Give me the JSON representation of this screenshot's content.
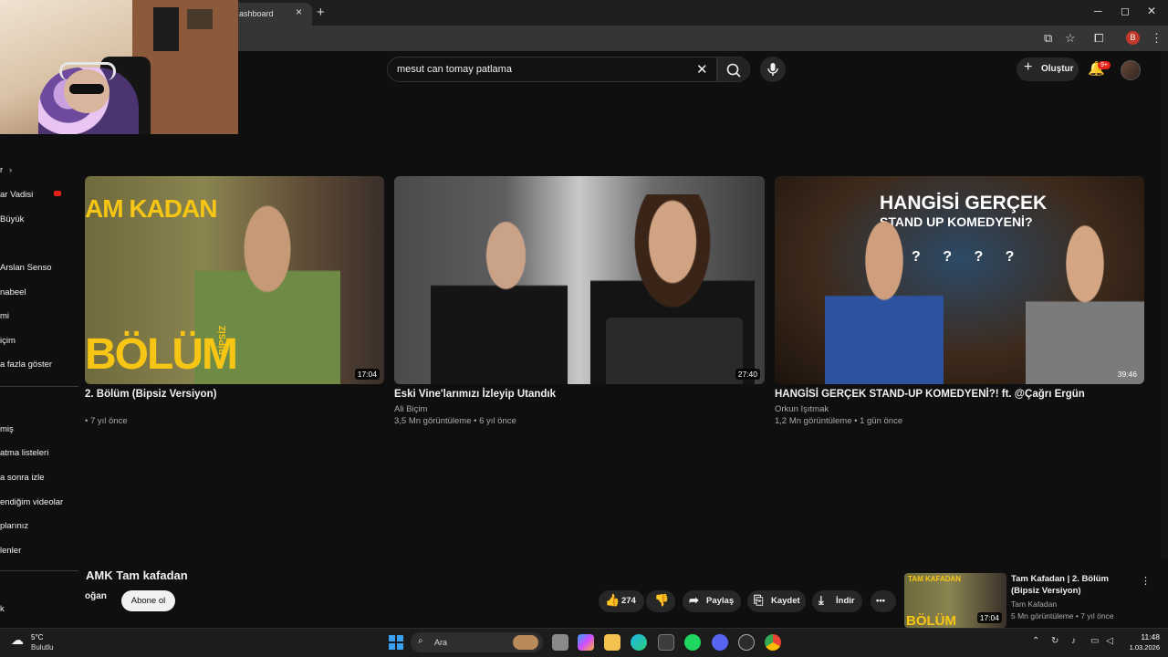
{
  "browser": {
    "tab_title": "ashboard",
    "tab_close": "×",
    "new_tab": "+",
    "window_controls": [
      "─",
      "◻",
      "✕"
    ],
    "profile_letter": "B"
  },
  "header": {
    "search_value": "mesut can tomay patlama",
    "create_label": "Oluştur",
    "notification_badge": "9+"
  },
  "sidebar": {
    "items": [
      "r",
      "ar Vadisi",
      "Büyük",
      "Arslan Senso",
      "nabeel",
      "mi",
      "içim",
      "a fazla göster",
      "miş",
      "atma listeleri",
      "a sonra izle",
      "endiğim videolar",
      "plarınız",
      "lenler",
      "k"
    ]
  },
  "videos": [
    {
      "title": "2. Bölüm (Bipsiz Versiyon)",
      "channel": "",
      "meta": "• 7 yıl önce",
      "duration": "17:04",
      "thumb_text": "BÖLÜM",
      "thumb_brand": "AM KADAN",
      "thumb_side": "BİPSİZ"
    },
    {
      "title": "Eski Vine'larımızı İzleyip Utandık",
      "channel": "Ali Biçim",
      "meta": "3,5 Mn görüntüleme • 6 yıl önce",
      "duration": "27:40"
    },
    {
      "title": "HANGİSİ GERÇEK STAND-UP KOMEDYENİ?! ft. @Çağrı Ergün",
      "channel": "Orkun Işıtmak",
      "meta": "1,2 Mn görüntüleme • 1 gün önce",
      "duration": "39:46",
      "thumb_line1": "HANGİSİ GERÇEK",
      "thumb_line2": "STAND UP KOMEDYENİ?",
      "thumb_marks": "? ? ? ?"
    }
  ],
  "player": {
    "title": "AMK Tam kafadan",
    "channel": "oğan",
    "subscribe": "Abone ol",
    "likes": "274",
    "share": "Paylaş",
    "save": "Kaydet",
    "download": "İndir",
    "more": "•••"
  },
  "recommendation": {
    "title": "Tam Kafadan | 2. Bölüm (Bipsiz Versiyon)",
    "channel": "Tam Kafadan",
    "meta": "5 Mn görüntüleme • 7 yıl önce",
    "duration": "17:04",
    "thumb_text": "BÖLÜM",
    "thumb_brand": "TAM KAFADAN"
  },
  "taskbar": {
    "weather_temp": "5°C",
    "weather_desc": "Bulutlu",
    "search_label": "Ara",
    "time": "11:48",
    "date": "1.03.2026"
  },
  "colors": {
    "background": "#0f0f0f",
    "chrome_bar": "#353535",
    "accent_red": "#e62117"
  }
}
